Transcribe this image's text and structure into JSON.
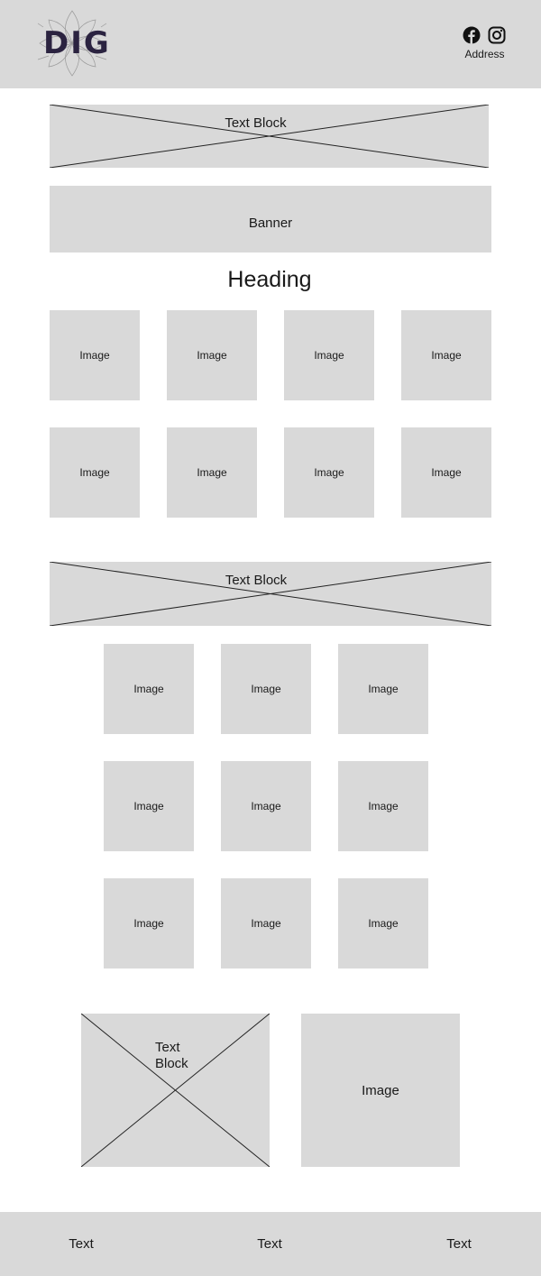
{
  "header": {
    "logo_text": "DIG",
    "icons": [
      "facebook-icon",
      "instagram-icon"
    ],
    "address": "Address"
  },
  "text_block_1": {
    "label": "Text Block"
  },
  "banner": {
    "label": "Banner"
  },
  "heading": {
    "text": "Heading"
  },
  "grid_1": {
    "items": [
      "Image",
      "Image",
      "Image",
      "Image",
      "Image",
      "Image",
      "Image",
      "Image"
    ]
  },
  "text_block_2": {
    "label": "Text Block"
  },
  "grid_2": {
    "items": [
      "Image",
      "Image",
      "Image",
      "Image",
      "Image",
      "Image",
      "Image",
      "Image",
      "Image"
    ]
  },
  "text_block_3": {
    "line1": "Text",
    "line2": "Block"
  },
  "feature_image": {
    "label": "Image"
  },
  "footer": {
    "items": [
      "Text",
      "Text",
      "Text"
    ]
  },
  "colors": {
    "placeholder": "#d9d9d9",
    "text": "#1a1a1a",
    "logo": "#2b2340"
  }
}
